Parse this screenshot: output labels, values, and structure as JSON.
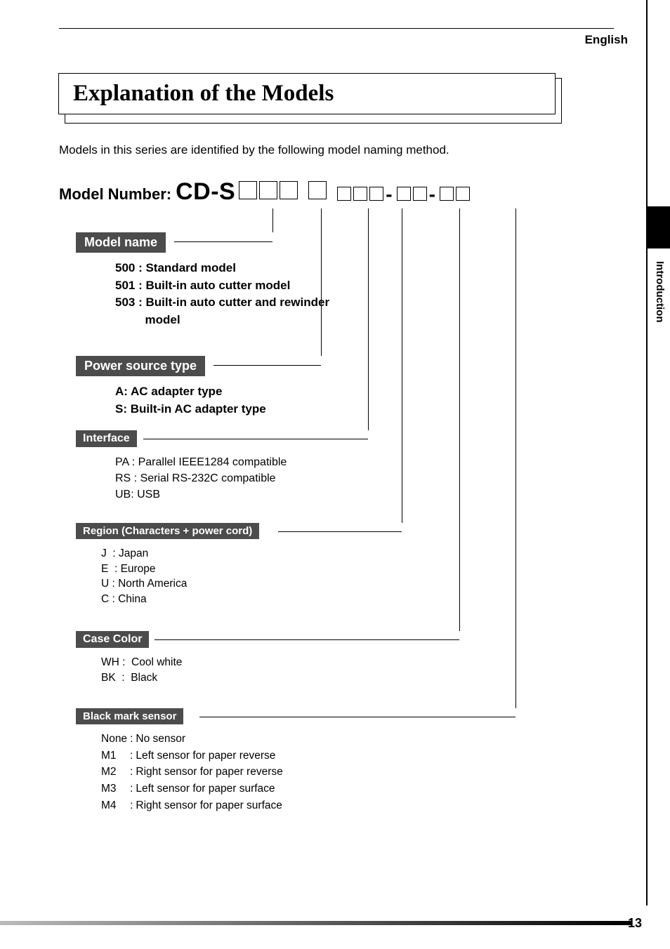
{
  "lang": "English",
  "title": "Explanation of the Models",
  "intro": "Models in this series are identified by the following model naming method.",
  "model_number_label": "Model Number:",
  "model_prefix": "CD-S",
  "sections": {
    "model_name": {
      "label": "Model name",
      "items": [
        "500 : Standard model",
        "501 : Built-in auto cutter model",
        "503 : Built-in auto cutter and rewinder",
        "         model"
      ]
    },
    "power": {
      "label": "Power source type",
      "items": [
        "A: AC adapter type",
        "S: Built-in AC adapter type"
      ]
    },
    "interface": {
      "label": "Interface",
      "items": [
        "PA : Parallel IEEE1284 compatible",
        "RS : Serial RS-232C compatible",
        "UB: USB"
      ]
    },
    "region": {
      "label": "Region (Characters + power cord)",
      "items": [
        "J  : Japan",
        "E  : Europe",
        "U : North America",
        "C : China"
      ]
    },
    "case_color": {
      "label": "Case Color",
      "items": [
        "WH :  Cool white",
        "BK  :  Black"
      ]
    },
    "black_mark": {
      "label": "Black mark sensor",
      "rows": [
        [
          "None",
          ":",
          "No sensor"
        ],
        [
          "M1",
          ":",
          "Left sensor for paper reverse"
        ],
        [
          "M2",
          ":",
          "Right sensor for paper reverse"
        ],
        [
          "M3",
          ":",
          "Left sensor for paper surface"
        ],
        [
          "M4",
          ":",
          "Right sensor for paper surface"
        ]
      ]
    }
  },
  "side_tab": "Introduction",
  "page_number": "13"
}
